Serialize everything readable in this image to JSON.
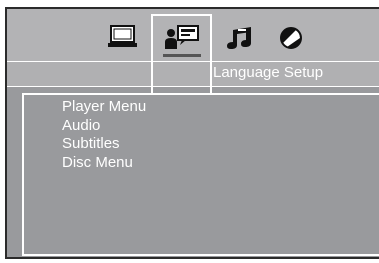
{
  "tabs": [
    {
      "icon": "monitor-icon",
      "label": ""
    },
    {
      "icon": "language-person-icon",
      "label": "",
      "selected": true
    },
    {
      "icon": "music-note-icon",
      "label": ""
    },
    {
      "icon": "disc-icon",
      "label": ""
    }
  ],
  "section": {
    "title": "Language Setup"
  },
  "menu": {
    "items": [
      {
        "label": "Player Menu"
      },
      {
        "label": "Audio"
      },
      {
        "label": "Subtitles"
      },
      {
        "label": "Disc Menu"
      }
    ]
  },
  "colors": {
    "background": "#999a9d",
    "topbar": "#b3b3b5",
    "text": "#ffffff",
    "frame": "#ffffff",
    "border": "#2b2b2b"
  }
}
